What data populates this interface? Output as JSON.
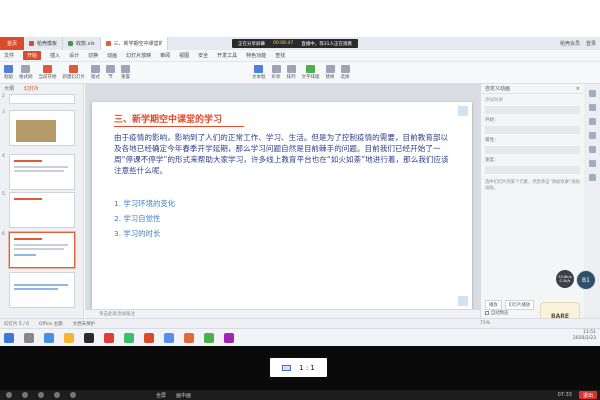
{
  "tabbar": {
    "app_label": "首页",
    "tabs": [
      {
        "label": "稻壳模板",
        "color": "#d94b2b"
      },
      {
        "label": "收款.xls",
        "color": "#3c9a4a"
      },
      {
        "label": "三、新学期空中课堂的学习.pptx",
        "color": "#e0603a"
      }
    ],
    "share": {
      "status": "正在分享屏幕",
      "time": "00:06:47",
      "viewers": "直播中，等31人正在观看"
    },
    "right_label": "稻壳会员",
    "user_label": "登录"
  },
  "menu": {
    "items": [
      "文件",
      "开始",
      "插入",
      "设计",
      "切换",
      "动画",
      "幻灯片放映",
      "审阅",
      "视图",
      "安全",
      "开发工具",
      "特色功能",
      "查找"
    ],
    "selected": "开始"
  },
  "ribbon": {
    "buttons": [
      {
        "label": "粘贴",
        "icon": "paste-icon"
      },
      {
        "label": "格式刷",
        "icon": "format-painter-icon"
      },
      {
        "label": "当前开始",
        "icon": "play-icon"
      },
      {
        "label": "新建幻灯片",
        "icon": "new-slide-icon"
      },
      {
        "label": "版式",
        "icon": "layout-icon"
      },
      {
        "label": "节",
        "icon": "section-icon"
      },
      {
        "label": "重置",
        "icon": "reset-icon"
      },
      {
        "label": "文本框",
        "icon": "textbox-icon"
      },
      {
        "label": "形状",
        "icon": "shape-icon"
      },
      {
        "label": "排列",
        "icon": "arrange-icon"
      },
      {
        "label": "文字排版",
        "icon": "text-layout-icon"
      },
      {
        "label": "替换",
        "icon": "replace-icon"
      },
      {
        "label": "选择",
        "icon": "select-icon"
      }
    ]
  },
  "leftpanel": {
    "tabs": [
      "大纲",
      "幻灯片"
    ],
    "active_tab": "幻灯片",
    "slide_numbers": [
      "2",
      "3",
      "4",
      "5",
      "6"
    ],
    "selected_slide": "5"
  },
  "slide": {
    "title": "三、新学期空中课堂的学习",
    "paragraph": "由于疫情的影响，影响到了人们的正常工作、学习、生活。但是为了控制疫情的需要，目前教育部以及各地已经确定今年春季开学延期，那么学习问题自然是目前棘手的问题。目前我们已经开始了一周“停课不停学”的形式来帮助大家学习，许多线上教育平台也在“如火如荼”地进行着，那么我们应该注意些什么呢。",
    "list": [
      "1. 学习环境的变化",
      "2. 学习自觉性",
      "3. 学习的时长"
    ]
  },
  "notes": {
    "placeholder": "单击此处添加备注"
  },
  "taskpane": {
    "title": "自定义动画",
    "add_effect": "添加效果",
    "fields": [
      "开始：",
      "属性：",
      "速度："
    ],
    "hint": "选中幻灯片的某个元素，然后单击“添加效果”添加动画。",
    "play_button": "播放",
    "slideshow_button": "幻灯片播放",
    "autopreview_label": "自动预览"
  },
  "status": {
    "slide_counter": "幻灯片 5 / 6",
    "theme": "Office 主题",
    "doc_status": "文档未保护",
    "zoom": "71%"
  },
  "overlay": {
    "speed_up": "52.8k/s",
    "speed_down": "0.3k/s",
    "b1_label": "B1",
    "panda_text": "BARE"
  },
  "tray": {
    "time": "11:51",
    "date": "2020/2/23"
  },
  "ratio_button": "1 : 1",
  "bottombar": {
    "fullscreen": "全屏",
    "pip": "画中画",
    "clock": "07:33",
    "exit": "退出"
  }
}
